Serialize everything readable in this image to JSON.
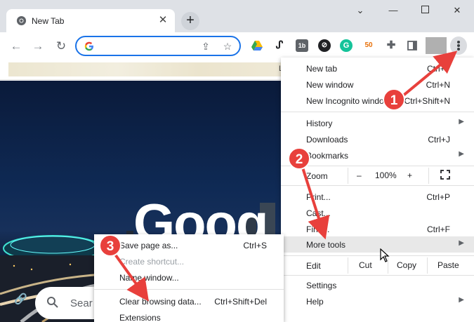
{
  "tab": {
    "title": "New Tab"
  },
  "toolbar": {
    "extensions": [
      {
        "name": "google-drive-icon",
        "color": "#34a853"
      },
      {
        "name": "signature-extension-icon",
        "color": "#202124"
      },
      {
        "name": "tab-extension-icon",
        "color": "#5f6368"
      },
      {
        "name": "link-extension-icon",
        "color": "#202124"
      },
      {
        "name": "grammarly-icon",
        "color": "#15c39a"
      },
      {
        "name": "coupon-extension-icon",
        "color": "#f4b400"
      },
      {
        "name": "puzzle-icon",
        "color": "#5f6368"
      },
      {
        "name": "side-panel-icon",
        "color": "#5f6368"
      }
    ]
  },
  "bookmarks": {
    "edge_text": "L"
  },
  "page": {
    "logo": "Goog",
    "search_placeholder": "Sear"
  },
  "menu": {
    "new_tab": {
      "label": "New tab",
      "shortcut": "Ctrl+T"
    },
    "new_window": {
      "label": "New window",
      "shortcut": "Ctrl+N"
    },
    "incognito": {
      "label": "New Incognito windo",
      "shortcut": "Ctrl+Shift+N"
    },
    "history": {
      "label": "History"
    },
    "downloads": {
      "label": "Downloads",
      "shortcut": "Ctrl+J"
    },
    "bookmarks": {
      "label": "Bookmarks"
    },
    "zoom": {
      "label": "Zoom",
      "minus": "–",
      "level": "100%",
      "plus": "+"
    },
    "print": {
      "label": "Print...",
      "shortcut": "Ctrl+P"
    },
    "cast": {
      "label": "Cast..."
    },
    "find": {
      "label": "Find...",
      "shortcut": "Ctrl+F"
    },
    "more_tools": {
      "label": "More tools"
    },
    "edit": {
      "label": "Edit",
      "cut": "Cut",
      "copy": "Copy",
      "paste": "Paste"
    },
    "settings": {
      "label": "Settings"
    },
    "help": {
      "label": "Help"
    }
  },
  "submenu": {
    "save_page": {
      "label": "Save page as...",
      "shortcut": "Ctrl+S"
    },
    "create_shortcut": {
      "label": "Create shortcut..."
    },
    "name_window": {
      "label": "Name window..."
    },
    "clear_data": {
      "label": "Clear browsing data...",
      "shortcut": "Ctrl+Shift+Del"
    },
    "extensions": {
      "label": "Extensions"
    }
  },
  "annotations": {
    "step1": "1",
    "step2": "2",
    "step3": "3",
    "color": "#e8403c"
  }
}
